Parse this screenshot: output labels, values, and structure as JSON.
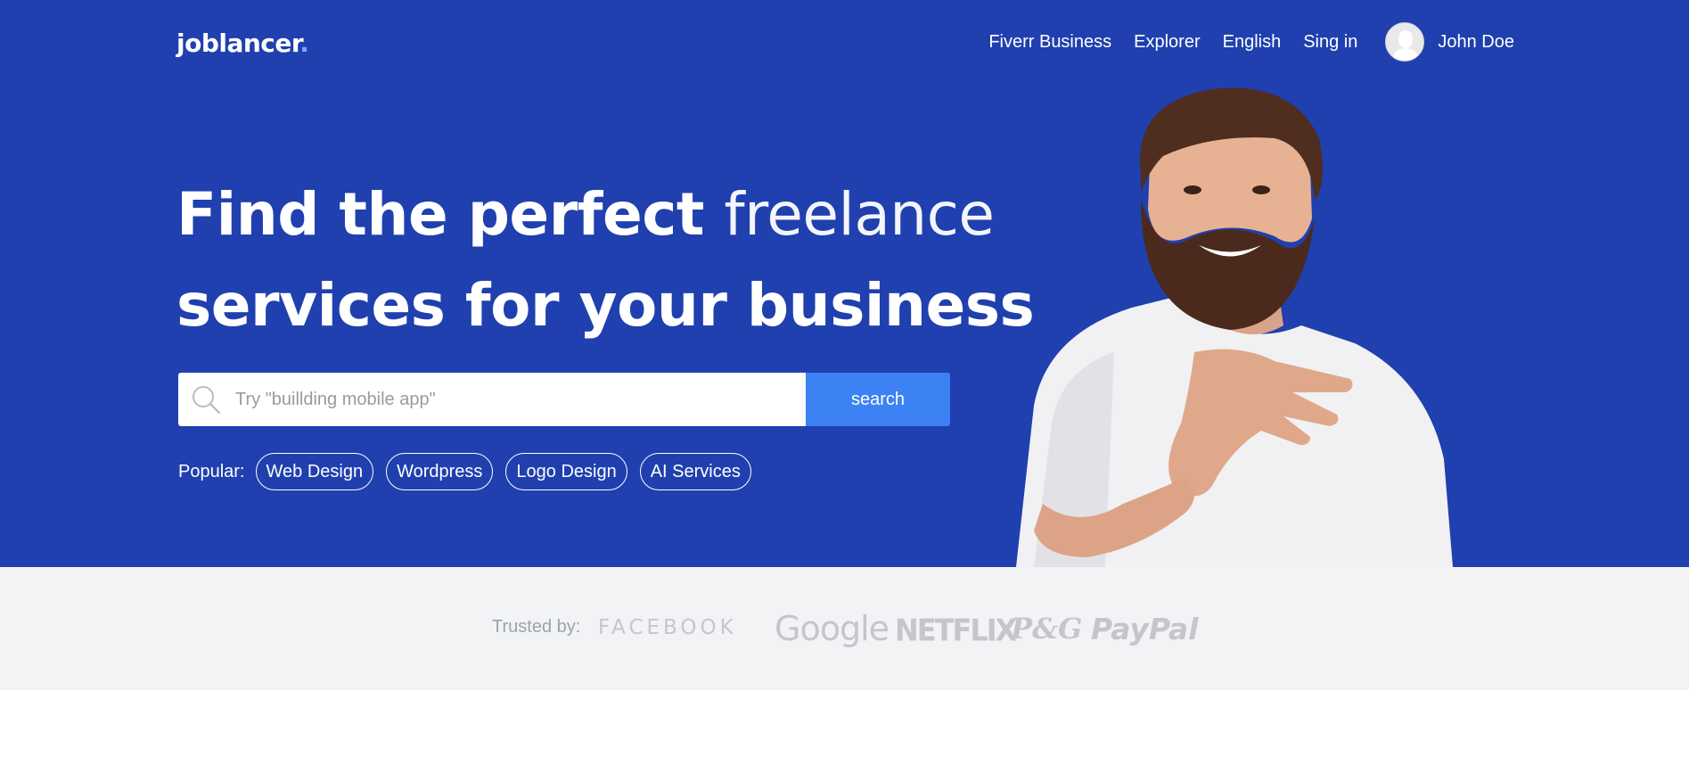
{
  "logo": {
    "text": "joblancer",
    "dot": "."
  },
  "nav": {
    "links": [
      "Fiverr Business",
      "Explorer",
      "English",
      "Sing in"
    ],
    "user_name": "John Doe"
  },
  "hero": {
    "headline_line1_bold": "Find the perfect",
    "headline_line1_light": "freelance",
    "headline_line2": "services for your business",
    "search_placeholder": "Try \"buillding mobile app\"",
    "search_button": "search",
    "popular_label": "Popular:",
    "popular_tags": [
      "Web Design",
      "Wordpress",
      "Logo Design",
      "AI Services"
    ]
  },
  "trusted": {
    "label": "Trusted by:",
    "brands": [
      "FACEBOOK",
      "Google",
      "NETFLIX",
      "P&G",
      "PayPal"
    ]
  },
  "colors": {
    "hero_bg": "#1f40ae",
    "search_button": "#3c82f4",
    "trusted_bg": "#f2f3f5",
    "brand_gray": "#c4c6cb"
  }
}
